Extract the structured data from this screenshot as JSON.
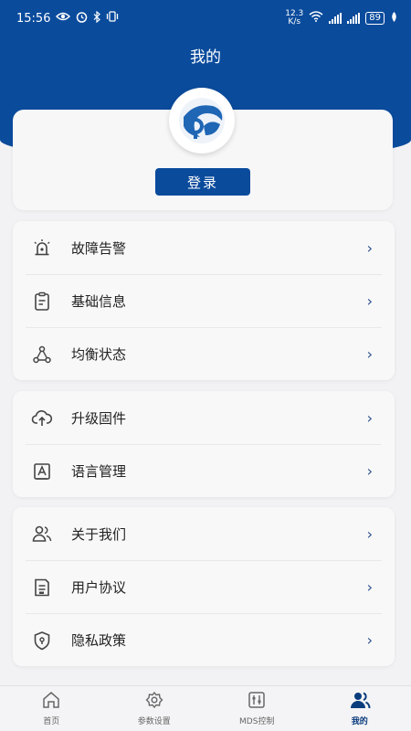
{
  "status_bar": {
    "time": "15:56",
    "net_speed_value": "12.3",
    "net_speed_unit": "K/s",
    "battery": "89"
  },
  "header": {
    "title": "我的"
  },
  "profile": {
    "login_label": "登录"
  },
  "menu_groups": [
    {
      "items": [
        {
          "label": "故障告警",
          "icon": "alarm-icon"
        },
        {
          "label": "基础信息",
          "icon": "info-card-icon"
        },
        {
          "label": "均衡状态",
          "icon": "network-icon"
        }
      ]
    },
    {
      "items": [
        {
          "label": "升级固件",
          "icon": "cloud-upload-icon"
        },
        {
          "label": "语言管理",
          "icon": "language-icon"
        }
      ]
    },
    {
      "items": [
        {
          "label": "关于我们",
          "icon": "users-icon"
        },
        {
          "label": "用户协议",
          "icon": "document-icon"
        },
        {
          "label": "隐私政策",
          "icon": "shield-icon"
        }
      ]
    }
  ],
  "tabbar": {
    "tabs": [
      {
        "label": "首页",
        "icon": "home-icon"
      },
      {
        "label": "参数设置",
        "icon": "settings-icon"
      },
      {
        "label": "MDS控制",
        "icon": "control-icon"
      },
      {
        "label": "我的",
        "icon": "profile-icon"
      }
    ],
    "active_index": 3
  },
  "colors": {
    "brand": "#0a4b9c",
    "background": "#f2f2f4"
  }
}
